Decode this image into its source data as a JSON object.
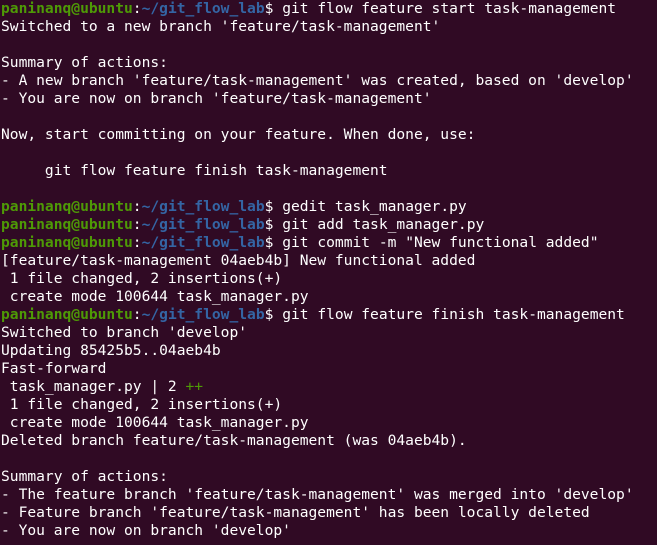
{
  "prompt": {
    "user_host": "paninanq@ubuntu",
    "colon": ":",
    "path": "~/git_flow_lab",
    "symbol": "$ "
  },
  "lines": [
    {
      "type": "prompt",
      "command": "git flow feature start task-management"
    },
    {
      "type": "text",
      "text": "Switched to a new branch 'feature/task-management'"
    },
    {
      "type": "text",
      "text": ""
    },
    {
      "type": "text",
      "text": "Summary of actions:"
    },
    {
      "type": "text",
      "text": "- A new branch 'feature/task-management' was created, based on 'develop'"
    },
    {
      "type": "text",
      "text": "- You are now on branch 'feature/task-management'"
    },
    {
      "type": "text",
      "text": ""
    },
    {
      "type": "text",
      "text": "Now, start committing on your feature. When done, use:"
    },
    {
      "type": "text",
      "text": ""
    },
    {
      "type": "text",
      "text": "     git flow feature finish task-management"
    },
    {
      "type": "text",
      "text": ""
    },
    {
      "type": "prompt",
      "command": "gedit task_manager.py"
    },
    {
      "type": "prompt",
      "command": "git add task_manager.py"
    },
    {
      "type": "prompt",
      "command": "git commit -m \"New functional added\""
    },
    {
      "type": "text",
      "text": "[feature/task-management 04aeb4b] New functional added"
    },
    {
      "type": "text",
      "text": " 1 file changed, 2 insertions(+)"
    },
    {
      "type": "text",
      "text": " create mode 100644 task_manager.py"
    },
    {
      "type": "prompt",
      "command": "git flow feature finish task-management"
    },
    {
      "type": "text",
      "text": "Switched to branch 'develop'"
    },
    {
      "type": "text",
      "text": "Updating 85425b5..04aeb4b"
    },
    {
      "type": "text",
      "text": "Fast-forward"
    },
    {
      "type": "diffstat",
      "text": " task_manager.py | 2 ",
      "plus": "++"
    },
    {
      "type": "text",
      "text": " 1 file changed, 2 insertions(+)"
    },
    {
      "type": "text",
      "text": " create mode 100644 task_manager.py"
    },
    {
      "type": "text",
      "text": "Deleted branch feature/task-management (was 04aeb4b)."
    },
    {
      "type": "text",
      "text": ""
    },
    {
      "type": "text",
      "text": "Summary of actions:"
    },
    {
      "type": "text",
      "text": "- The feature branch 'feature/task-management' was merged into 'develop'"
    },
    {
      "type": "text",
      "text": "- Feature branch 'feature/task-management' has been locally deleted"
    },
    {
      "type": "text",
      "text": "- You are now on branch 'develop'"
    }
  ],
  "colors": {
    "background": "#300a24",
    "user": "#4e9a06",
    "path": "#3465a4",
    "text": "#ffffff",
    "plus": "#4e9a06"
  }
}
